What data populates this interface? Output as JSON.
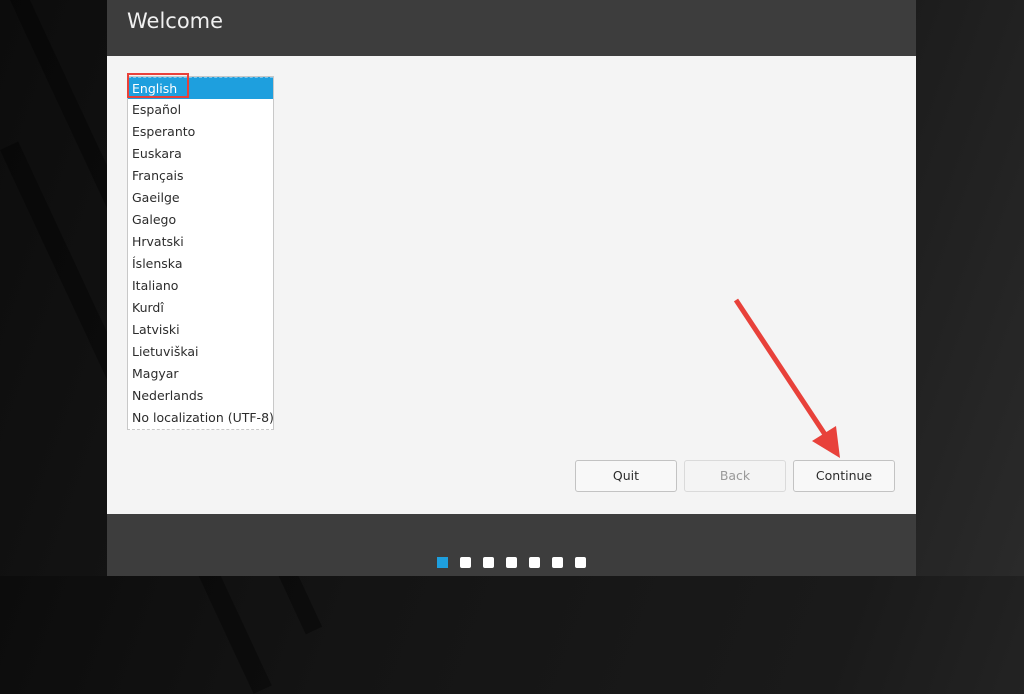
{
  "window": {
    "title": "Welcome"
  },
  "languages": {
    "selected": "English",
    "items": [
      "English",
      "Español",
      "Esperanto",
      "Euskara",
      "Français",
      "Gaeilge",
      "Galego",
      "Hrvatski",
      "Íslenska",
      "Italiano",
      "Kurdî",
      "Latviski",
      "Lietuviškai",
      "Magyar",
      "Nederlands",
      "No localization (UTF-8)"
    ]
  },
  "buttons": {
    "quit": "Quit",
    "back": "Back",
    "continue": "Continue"
  },
  "progress": {
    "total_steps": 7,
    "current_step": 1
  },
  "colors": {
    "accent": "#1e9fde",
    "annotation": "#e8413a",
    "header_bg": "#3d3d3d"
  },
  "annotations": {
    "highlight_target": "English",
    "arrow_target": "Continue"
  }
}
